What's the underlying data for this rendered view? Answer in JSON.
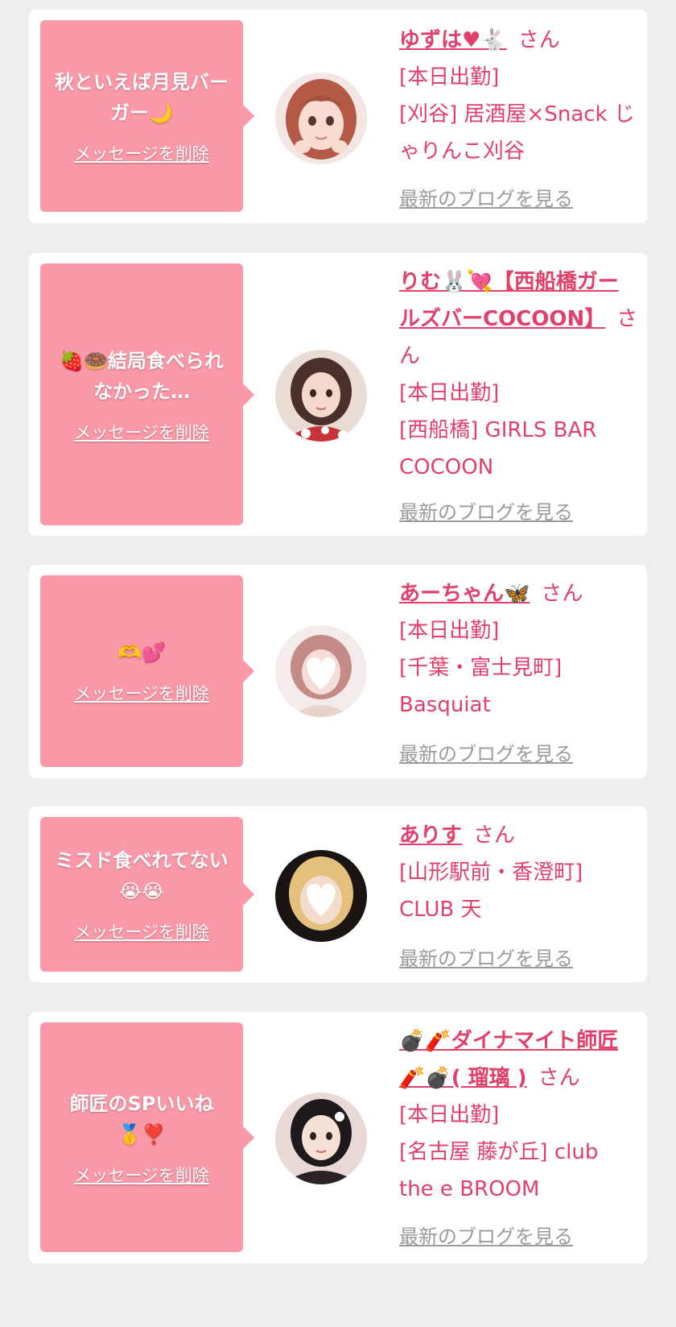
{
  "messages": [
    {
      "message": "秋といえば月見バーガー🌙",
      "delete_label": "メッセージを削除",
      "name": "ゆずは♥🐇",
      "suffix": "さん",
      "status": "[本日出勤]",
      "shop": "[刈谷] 居酒屋×Snack じゃりんこ刈谷",
      "blog_label": "最新のブログを見る"
    },
    {
      "message": "🍓🍩結局食べられなかった…",
      "delete_label": "メッセージを削除",
      "name": "りむ🐰💘【西船橋ガールズバーCOCOON】",
      "suffix": "さん",
      "status": "[本日出勤]",
      "shop": "[西船橋] GIRLS BAR COCOON",
      "blog_label": "最新のブログを見る"
    },
    {
      "message": "🫶💕",
      "delete_label": "メッセージを削除",
      "name": "あーちゃん🦋",
      "suffix": "さん",
      "status": "[本日出勤]",
      "shop": "[千葉・富士見町] Basquiat",
      "blog_label": "最新のブログを見る"
    },
    {
      "message": "ミスド食べれてない😭😭",
      "delete_label": "メッセージを削除",
      "name": "ありす",
      "suffix": "さん",
      "status": "",
      "shop": "[山形駅前・香澄町] CLUB 天",
      "blog_label": "最新のブログを見る"
    },
    {
      "message": "師匠のSPいいね🥇❣️",
      "delete_label": "メッセージを削除",
      "name": "💣🧨ダイナマイト師匠🧨💣( 瑠璃 )",
      "suffix": "さん",
      "status": "[本日出勤]",
      "shop": "[名古屋 藤が丘] club the e BROOM",
      "blog_label": "最新のブログを見る"
    }
  ],
  "colors": {
    "page_bg": "#efeeef",
    "card_bg": "#ffffff",
    "bubble_bg": "#fc99a8",
    "accent": "#e0406a",
    "link_gray": "#9b9b9b"
  }
}
